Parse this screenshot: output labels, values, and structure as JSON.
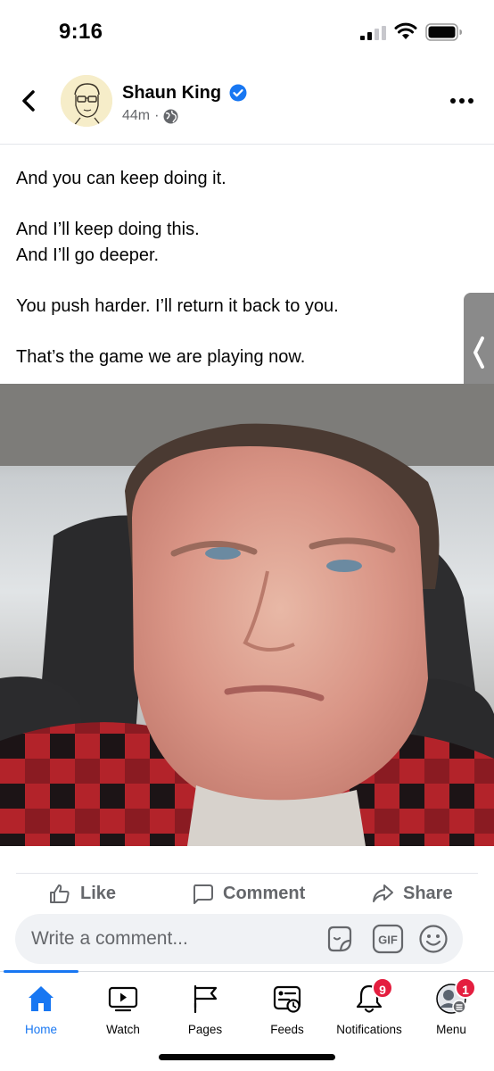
{
  "status_bar": {
    "time": "9:16",
    "icons": [
      "cellular-signal-icon",
      "wifi-icon",
      "battery-icon"
    ]
  },
  "post": {
    "author": "Shaun King",
    "verified": true,
    "timestamp": "44m",
    "meta_separator": "·",
    "audience_icon": "globe-icon",
    "paragraphs": [
      "And you can keep doing it.",
      "And I’ll keep doing this.\nAnd I’ll go deeper.",
      "You push harder. I’ll return it back to you.",
      "That’s the game we are playing now."
    ]
  },
  "actions": {
    "like": "Like",
    "comment": "Comment",
    "share": "Share"
  },
  "comment_bar": {
    "placeholder": "Write a comment...",
    "gif_label": "GIF"
  },
  "bottom_nav": {
    "items": [
      {
        "label": "Home",
        "icon": "home-icon",
        "active": true
      },
      {
        "label": "Watch",
        "icon": "watch-icon"
      },
      {
        "label": "Pages",
        "icon": "pages-flag-icon"
      },
      {
        "label": "Feeds",
        "icon": "feeds-icon"
      },
      {
        "label": "Notifications",
        "icon": "bell-icon",
        "badge": "9"
      },
      {
        "label": "Menu",
        "icon": "profile-menu-icon",
        "badge": "1"
      }
    ]
  },
  "colors": {
    "accent": "#1877f2",
    "verified": "#1877f2",
    "badge": "#e41e3f",
    "secondary_text": "#65676b",
    "comment_bar_bg": "#f0f2f5"
  }
}
